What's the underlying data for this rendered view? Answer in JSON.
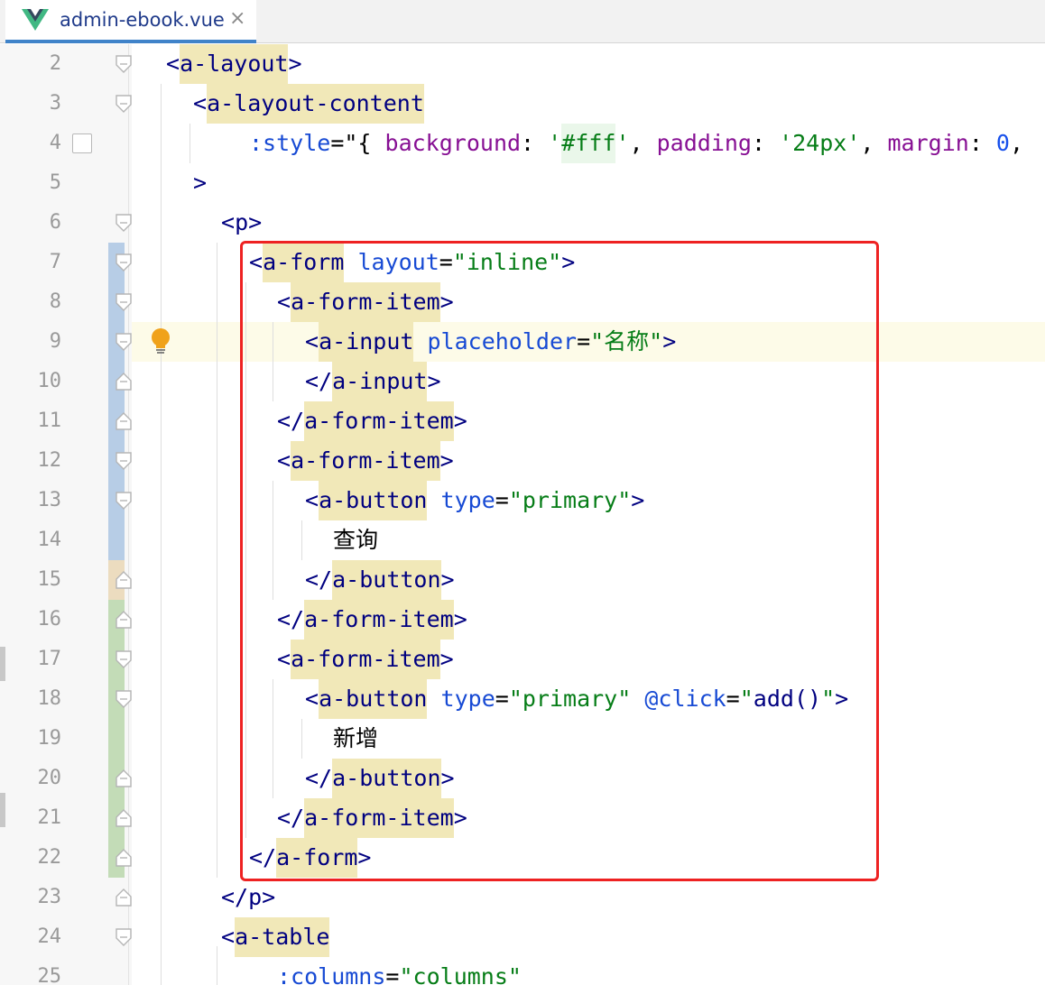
{
  "tab": {
    "title": "admin-ebook.vue",
    "icon": "vue-logo-icon",
    "close": "×",
    "accent": "#4083c9"
  },
  "colors": {
    "tag": "#000080",
    "tag_highlight": "#f1e8b8",
    "attribute": "#174ad4",
    "string": "#067d17",
    "property": "#871094",
    "number": "#1750eb",
    "selection_box": "#ee2222"
  },
  "lines": [
    {
      "n": "2"
    },
    {
      "n": "3"
    },
    {
      "n": "4"
    },
    {
      "n": "5"
    },
    {
      "n": "6"
    },
    {
      "n": "7"
    },
    {
      "n": "8"
    },
    {
      "n": "9"
    },
    {
      "n": "10"
    },
    {
      "n": "11"
    },
    {
      "n": "12"
    },
    {
      "n": "13"
    },
    {
      "n": "14"
    },
    {
      "n": "15"
    },
    {
      "n": "16"
    },
    {
      "n": "17"
    },
    {
      "n": "18"
    },
    {
      "n": "19"
    },
    {
      "n": "20"
    },
    {
      "n": "21"
    },
    {
      "n": "22"
    },
    {
      "n": "23"
    },
    {
      "n": "24"
    },
    {
      "n": "25"
    }
  ],
  "code": {
    "l2": {
      "open": "<",
      "tag": "a-layout",
      "close": ">"
    },
    "l3": {
      "open": "<",
      "tag": "a-layout-content"
    },
    "l4": {
      "attr": ":style",
      "eq": "=\"{ ",
      "p1": "background",
      "c1": ": ",
      "v1": "'",
      "v1b": "#fff",
      "v1c": "'",
      "sep1": ", ",
      "p2": "padding",
      "c2": ": ",
      "v2": "'24px'",
      "sep2": ", ",
      "p3": "margin",
      "c3": ": ",
      "v3": "0",
      "sep3": ","
    },
    "l5": {
      "close": ">"
    },
    "l6": {
      "open": "<",
      "tag": "p",
      "close": ">"
    },
    "l7": {
      "open": "<",
      "tag": "a-form",
      "sp": " ",
      "attr": "layout",
      "eq": "=",
      "val": "\"inline\"",
      "close": ">"
    },
    "l8": {
      "open": "<",
      "tag": "a-form-item",
      "close": ">"
    },
    "l9": {
      "open": "<",
      "tag": "a-input",
      "sp": " ",
      "attr": "placeholder",
      "eq": "=",
      "val": "\"名称\"",
      "close": ">"
    },
    "l10": {
      "open": "</",
      "tag": "a-input",
      "close": ">"
    },
    "l11": {
      "open": "</",
      "tag": "a-form-item",
      "close": ">"
    },
    "l12": {
      "open": "<",
      "tag": "a-form-item",
      "close": ">"
    },
    "l13": {
      "open": "<",
      "tag": "a-button",
      "sp": " ",
      "attr": "type",
      "eq": "=",
      "val": "\"primary\"",
      "close": ">"
    },
    "l14": {
      "text": "查询"
    },
    "l15": {
      "open": "</",
      "tag": "a-button",
      "close": ">"
    },
    "l16": {
      "open": "</",
      "tag": "a-form-item",
      "close": ">"
    },
    "l17": {
      "open": "<",
      "tag": "a-form-item",
      "close": ">"
    },
    "l18": {
      "open": "<",
      "tag": "a-button",
      "sp": " ",
      "attr": "type",
      "eq": "=",
      "val": "\"primary\"",
      "sp2": " ",
      "attr2": "@click",
      "eq2": "=",
      "val2a": "\"",
      "val2b": "add()",
      "val2c": "\"",
      "close": ">"
    },
    "l19": {
      "text": "新增"
    },
    "l20": {
      "open": "</",
      "tag": "a-button",
      "close": ">"
    },
    "l21": {
      "open": "</",
      "tag": "a-form-item",
      "close": ">"
    },
    "l22": {
      "open": "</",
      "tag": "a-form",
      "close": ">"
    },
    "l23": {
      "open": "</",
      "tag": "p",
      "close": ">"
    },
    "l24": {
      "open": "<",
      "tag": "a-table"
    },
    "l25": {
      "attr": ":columns",
      "eq": "=",
      "val": "\"columns\""
    }
  },
  "gutter": {
    "bookmark_line": "4",
    "intention_bulb_line": "9",
    "caret_line": "9",
    "vcs_changes": [
      {
        "from_line": "7",
        "to_line": "14",
        "kind": "modified",
        "color": "#b7cde6"
      },
      {
        "from_line": "15",
        "to_line": "15",
        "kind": "modified-deleted",
        "color": "#ecdcbf"
      },
      {
        "from_line": "16",
        "to_line": "22",
        "kind": "added",
        "color": "#c3dcb7"
      }
    ]
  }
}
